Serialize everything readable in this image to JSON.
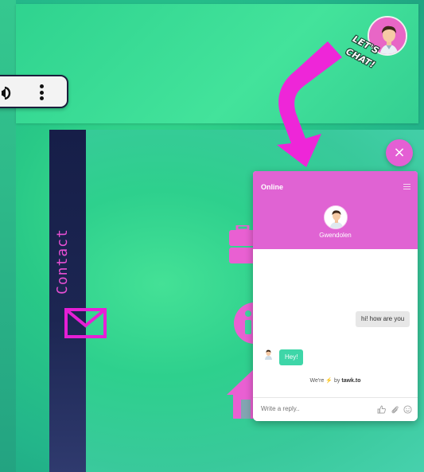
{
  "top_banner": {
    "badge_text": "LET'S CHAT!"
  },
  "media_controls": {
    "speaker_icon": "speaker-icon",
    "menu_icon": "kebab-menu-icon"
  },
  "sidebar": {
    "label": "Contact",
    "mail_icon": "mail-icon"
  },
  "background_icons": [
    "briefcase-icon",
    "info-icon",
    "home-icon"
  ],
  "arrow": {
    "icon": "curved-arrow-icon",
    "color": "#ee26d8"
  },
  "close_button": {
    "label": "×"
  },
  "chat": {
    "status": "Online",
    "agent_name": "Gwendolen",
    "messages": [
      {
        "direction": "out",
        "text": "hi! how are you"
      },
      {
        "direction": "in",
        "text": "Hey!"
      }
    ],
    "powered_prefix": "We're",
    "powered_bolt": "⚡",
    "powered_mid": "by",
    "powered_brand": "tawk.to",
    "input_placeholder": "Write a reply..",
    "input_icons": [
      "thumbs-up-icon",
      "paperclip-icon",
      "emoji-icon"
    ]
  },
  "colors": {
    "accent": "#e063d3",
    "agent_bubble": "#3ed6a8",
    "sidebar": "#1c2652",
    "background": "#2ed08d"
  }
}
